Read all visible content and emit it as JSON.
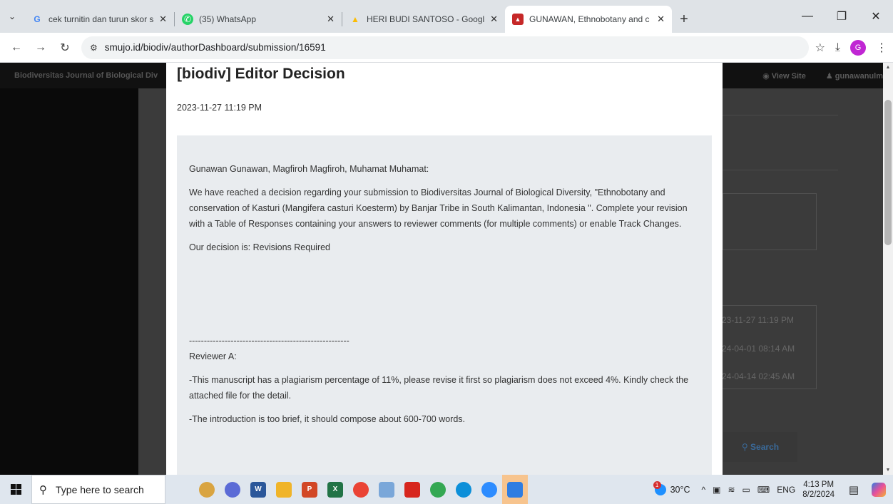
{
  "browser": {
    "tabs": [
      {
        "title": "cek turnitin dan turun skor shop",
        "favicon": "google-g-icon",
        "color": "#4285f4",
        "active": false
      },
      {
        "title": "(35) WhatsApp",
        "favicon": "whatsapp-icon",
        "color": "#25d366",
        "active": false
      },
      {
        "title": "HERI BUDI SANTOSO - Google",
        "favicon": "google-drive-icon",
        "color": "#fbbc04",
        "active": false
      },
      {
        "title": "GUNAWAN, Ethnobotany and c",
        "favicon": "journal-icon",
        "color": "#c62828",
        "active": true
      }
    ],
    "url": "smujo.id/biodiv/authorDashboard/submission/16591",
    "profile_initial": "G"
  },
  "site": {
    "brand": "Biodiversitas Journal of Biological Div",
    "nav_view_site": "View Site",
    "nav_user": "gunawanulm",
    "dates": [
      "23-11-27 11:19 PM",
      "24-04-01 08:14 AM",
      "24-04-14 02:45 AM"
    ],
    "search_label": "Search"
  },
  "modal": {
    "title": "[biodiv] Editor Decision",
    "date": "2023-11-27 11:19 PM",
    "salutation": "Gunawan Gunawan, Magfiroh Magfiroh, Muhamat Muhamat:",
    "body": "We have reached a decision regarding your submission to Biodiversitas Journal of Biological Diversity, \"Ethnobotany and conservation of Kasturi (Mangifera casturi Koesterm) by Banjar Tribe in South Kalimantan, Indonesia \". Complete your revision with a Table of Responses containing your answers to reviewer comments (for multiple comments) or enable Track Changes.",
    "decision": "Our decision is: Revisions Required",
    "divider": "------------------------------------------------------",
    "reviewer": "Reviewer A:",
    "comment1": "-This manuscript has a plagiarism percentage of 11%, please revise it first so plagiarism does not exceed 4%. Kindly check the attached file for the detail.",
    "comment2": "-The introduction is too brief, it should compose about 600-700 words."
  },
  "taskbar": {
    "search_placeholder": "Type here to search",
    "apps": [
      {
        "name": "app-hat-icon",
        "color": "#d9a441",
        "label": ""
      },
      {
        "name": "app-search-tool-icon",
        "color": "#5b6bd6",
        "label": ""
      },
      {
        "name": "word-icon",
        "color": "#2b579a",
        "label": "W"
      },
      {
        "name": "file-explorer-icon",
        "color": "#f0b429",
        "label": ""
      },
      {
        "name": "powerpoint-icon",
        "color": "#d24726",
        "label": "P"
      },
      {
        "name": "excel-icon",
        "color": "#217346",
        "label": "X"
      },
      {
        "name": "chrome-icon",
        "color": "#ea4335",
        "label": ""
      },
      {
        "name": "app-generic-icon",
        "color": "#7aa7d9",
        "label": ""
      },
      {
        "name": "acrobat-icon",
        "color": "#d7261e",
        "label": ""
      },
      {
        "name": "chrome-profile-icon",
        "color": "#34a853",
        "label": ""
      },
      {
        "name": "edge-icon",
        "color": "#0c8fd9",
        "label": ""
      },
      {
        "name": "zoom-icon",
        "color": "#2d8cff",
        "label": ""
      },
      {
        "name": "app-active-icon",
        "color": "#2f7de1",
        "label": ""
      }
    ],
    "weather_temp": "30°C",
    "weather_badge": "1",
    "lang": "ENG",
    "time": "4:13 PM",
    "date": "8/2/2024"
  }
}
